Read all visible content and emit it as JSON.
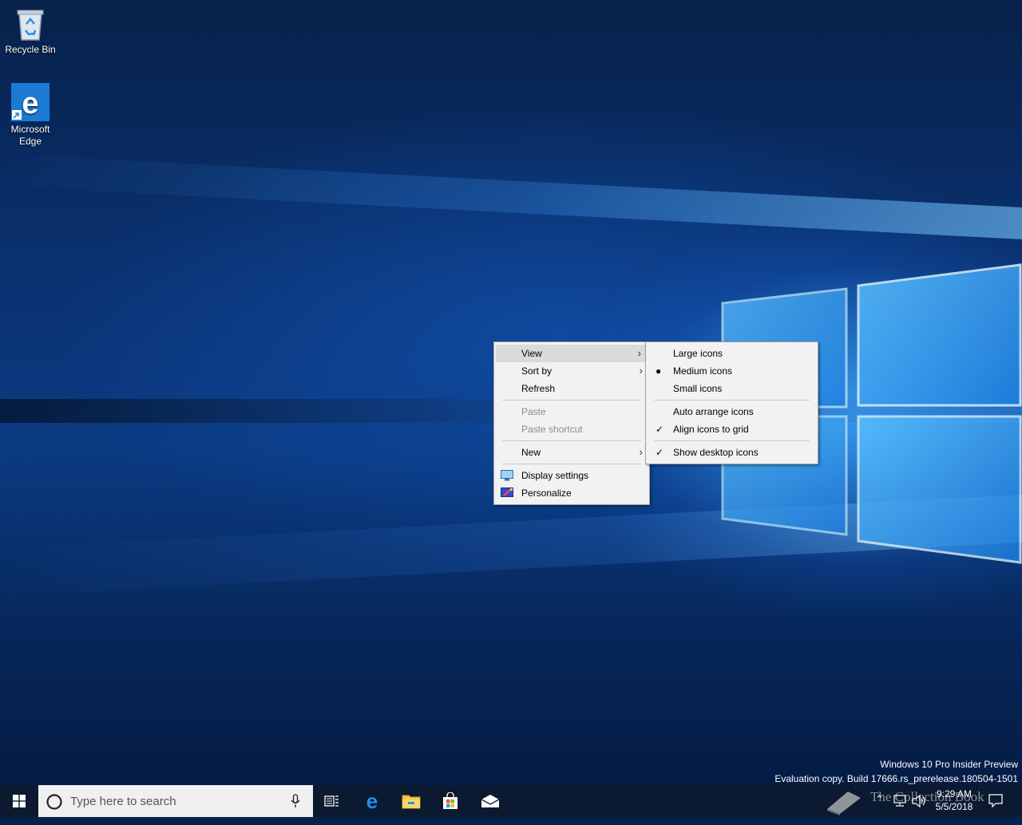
{
  "desktop": {
    "icons": [
      {
        "label": "Recycle Bin"
      },
      {
        "label": "Microsoft Edge"
      }
    ]
  },
  "context_menu": {
    "items": {
      "view": "View",
      "sort_by": "Sort by",
      "refresh": "Refresh",
      "paste": "Paste",
      "paste_shortcut": "Paste shortcut",
      "new": "New",
      "display_settings": "Display settings",
      "personalize": "Personalize"
    },
    "hovered": "View"
  },
  "view_submenu": {
    "items": {
      "large_icons": "Large icons",
      "medium_icons": "Medium icons",
      "small_icons": "Small icons",
      "auto_arrange": "Auto arrange icons",
      "align_grid": "Align icons to grid",
      "show_desktop_icons": "Show desktop icons"
    },
    "selected_size": "Medium icons",
    "checked": [
      "Align icons to grid",
      "Show desktop icons"
    ]
  },
  "watermark": {
    "line1": "Windows 10 Pro Insider Preview",
    "line2": "Evaluation copy. Build 17666.rs_prerelease.180504-1501"
  },
  "taskbar": {
    "search_placeholder": "Type here to search",
    "clock_time": "9:29 AM",
    "clock_date": "5/5/2018",
    "overlay_text": "The Collection Book",
    "background_color": "#0b1a30"
  }
}
